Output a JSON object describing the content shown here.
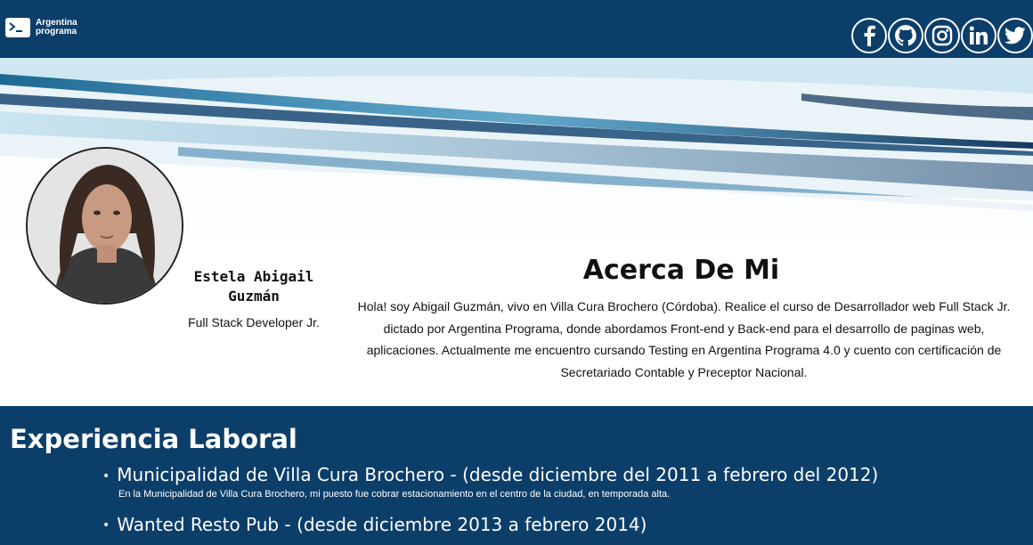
{
  "header": {
    "logo_line1": "Argentina",
    "logo_line2": "programa",
    "socials": [
      {
        "name": "facebook-icon"
      },
      {
        "name": "github-icon"
      },
      {
        "name": "instagram-icon"
      },
      {
        "name": "linkedin-icon"
      },
      {
        "name": "twitter-icon"
      }
    ],
    "bg_color": "#0c3e6a"
  },
  "profile": {
    "name": "Estela Abigail Guzmán",
    "role": "Full Stack Developer Jr."
  },
  "about": {
    "title": "Acerca De Mi",
    "text": "Hola! soy Abigail Guzmán, vivo en Villa Cura Brochero (Córdoba). Realice el curso de Desarrollador web Full Stack Jr. dictado por Argentina Programa, donde abordamos Front-end y Back-end para el desarrollo de paginas web, aplicaciones. Actualmente me encuentro cursando Testing en Argentina Programa 4.0 y cuento con certificación de Secretariado Contable y Preceptor Nacional."
  },
  "experience": {
    "title": "Experiencia Laboral",
    "items": [
      {
        "heading": "Municipalidad de Villa Cura Brochero - (desde diciembre del 2011 a febrero del 2012)",
        "description": "En la Municipalidad de Villa Cura Brochero, mi puesto fue cobrar estacionamiento en el centro de la ciudad, en temporada alta."
      },
      {
        "heading": "Wanted Resto Pub - (desde diciembre 2013 a febrero 2014)",
        "description": ""
      }
    ]
  }
}
